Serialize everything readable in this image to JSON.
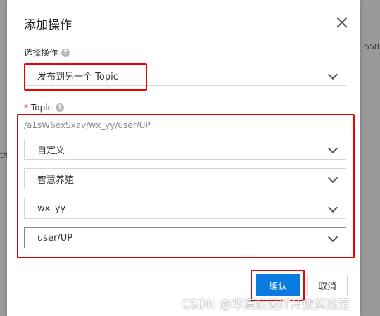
{
  "background": {
    "fragment_right": "558",
    "fragment_left": "th"
  },
  "dialog": {
    "title": "添加操作",
    "operation": {
      "label": "选择操作",
      "value": "发布到另一个 Topic"
    },
    "topic": {
      "required_mark": "*",
      "label": "Topic",
      "path": "/a1sW6exSxav/wx_yy/user/UP",
      "selects": [
        "自定义",
        "智慧养殖",
        "wx_yy",
        "user/UP"
      ]
    },
    "buttons": {
      "confirm": "确认",
      "cancel": "取消"
    }
  },
  "watermark": "CSDN @华清远见IT开放实验室",
  "colors": {
    "primary": "#0a7ae0",
    "highlight": "#e00000",
    "required": "#e0301e"
  }
}
